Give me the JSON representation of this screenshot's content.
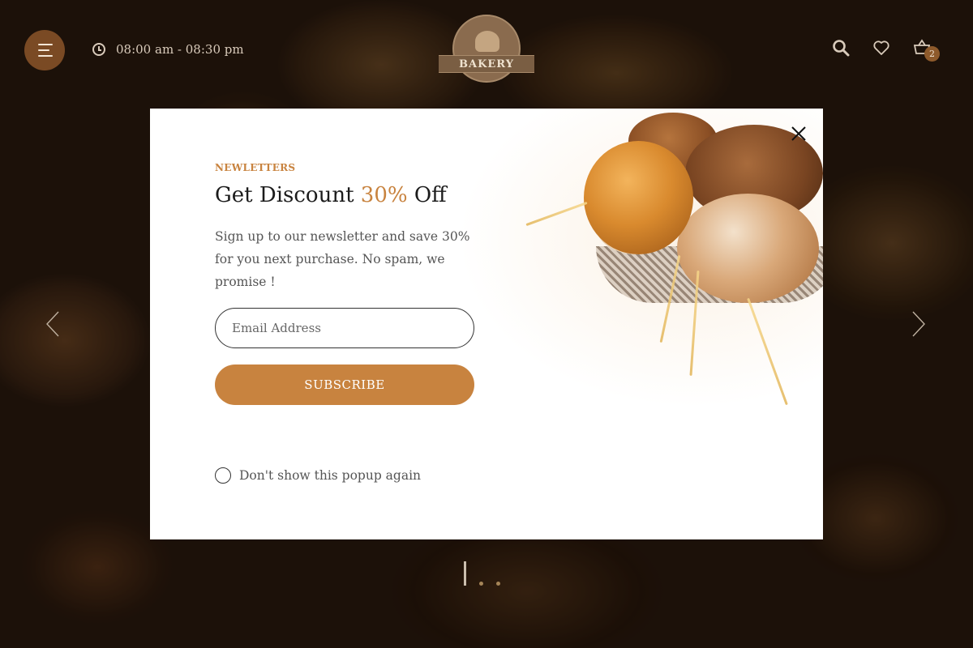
{
  "header": {
    "hours": "08:00 am - 08:30 pm",
    "logo_text": "BAKERY",
    "cart_count": "2",
    "icons": [
      "menu-icon",
      "clock-icon",
      "search-icon",
      "heart-icon",
      "basket-icon"
    ]
  },
  "slider": {
    "prev_icon": "chevron-left-icon",
    "next_icon": "chevron-right-icon",
    "pages": 3,
    "active_page": 1
  },
  "popup": {
    "eyebrow": "NEWLETTERS",
    "title_prefix": "Get Discount ",
    "title_accent": "30%",
    "title_suffix": " Off",
    "description": "Sign up to our newsletter and save 30% for you next purchase. No spam, we promise !",
    "email_placeholder": "Email Address",
    "email_value": "",
    "subscribe_label": "SUBSCRIBE",
    "dont_show_label": "Don't show this popup again",
    "close_icon": "close-icon"
  },
  "colors": {
    "accent": "#c8833f",
    "menu_button": "#7a4a24",
    "cart_badge": "#8e5a2b"
  }
}
